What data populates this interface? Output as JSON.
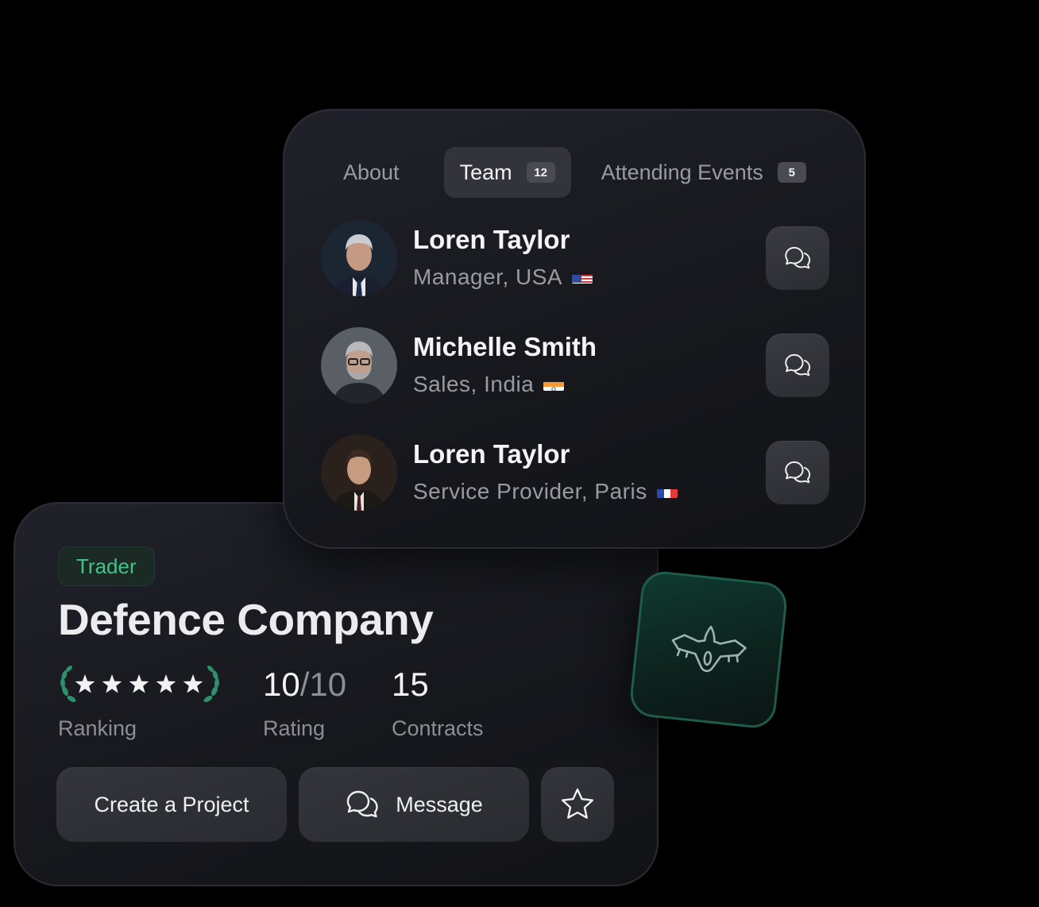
{
  "team_card": {
    "tabs": [
      {
        "label": "About",
        "count": null,
        "active": false
      },
      {
        "label": "Team",
        "count": "12",
        "active": true
      },
      {
        "label": "Attending Events",
        "count": "5",
        "active": false
      }
    ],
    "members": [
      {
        "name": "Loren Taylor",
        "role": "Manager, USA",
        "flag": "us-flag"
      },
      {
        "name": "Michelle Smith",
        "role": "Sales, India",
        "flag": "india-flag"
      },
      {
        "name": "Loren Taylor",
        "role": "Service Provider, Paris",
        "flag": "france-flag"
      }
    ],
    "chat_icon": "chat-bubbles-icon"
  },
  "company_card": {
    "badge": "Trader",
    "name": "Defence Company",
    "stats": {
      "ranking": {
        "label": "Ranking",
        "stars": 5
      },
      "rating": {
        "value": "10",
        "separator": "/",
        "max": "10",
        "label": "Rating"
      },
      "contracts": {
        "value": "15",
        "label": "Contracts"
      }
    },
    "actions": {
      "create_project": "Create a Project",
      "message": "Message",
      "favorite_icon": "star-outline-icon"
    }
  },
  "plane_tile": {
    "icon": "fighter-jet-icon"
  },
  "colors": {
    "accent_green": "#3fc386",
    "laurel_green": "#2f8f6b",
    "background": "#000000",
    "card": "#1b1c22"
  }
}
